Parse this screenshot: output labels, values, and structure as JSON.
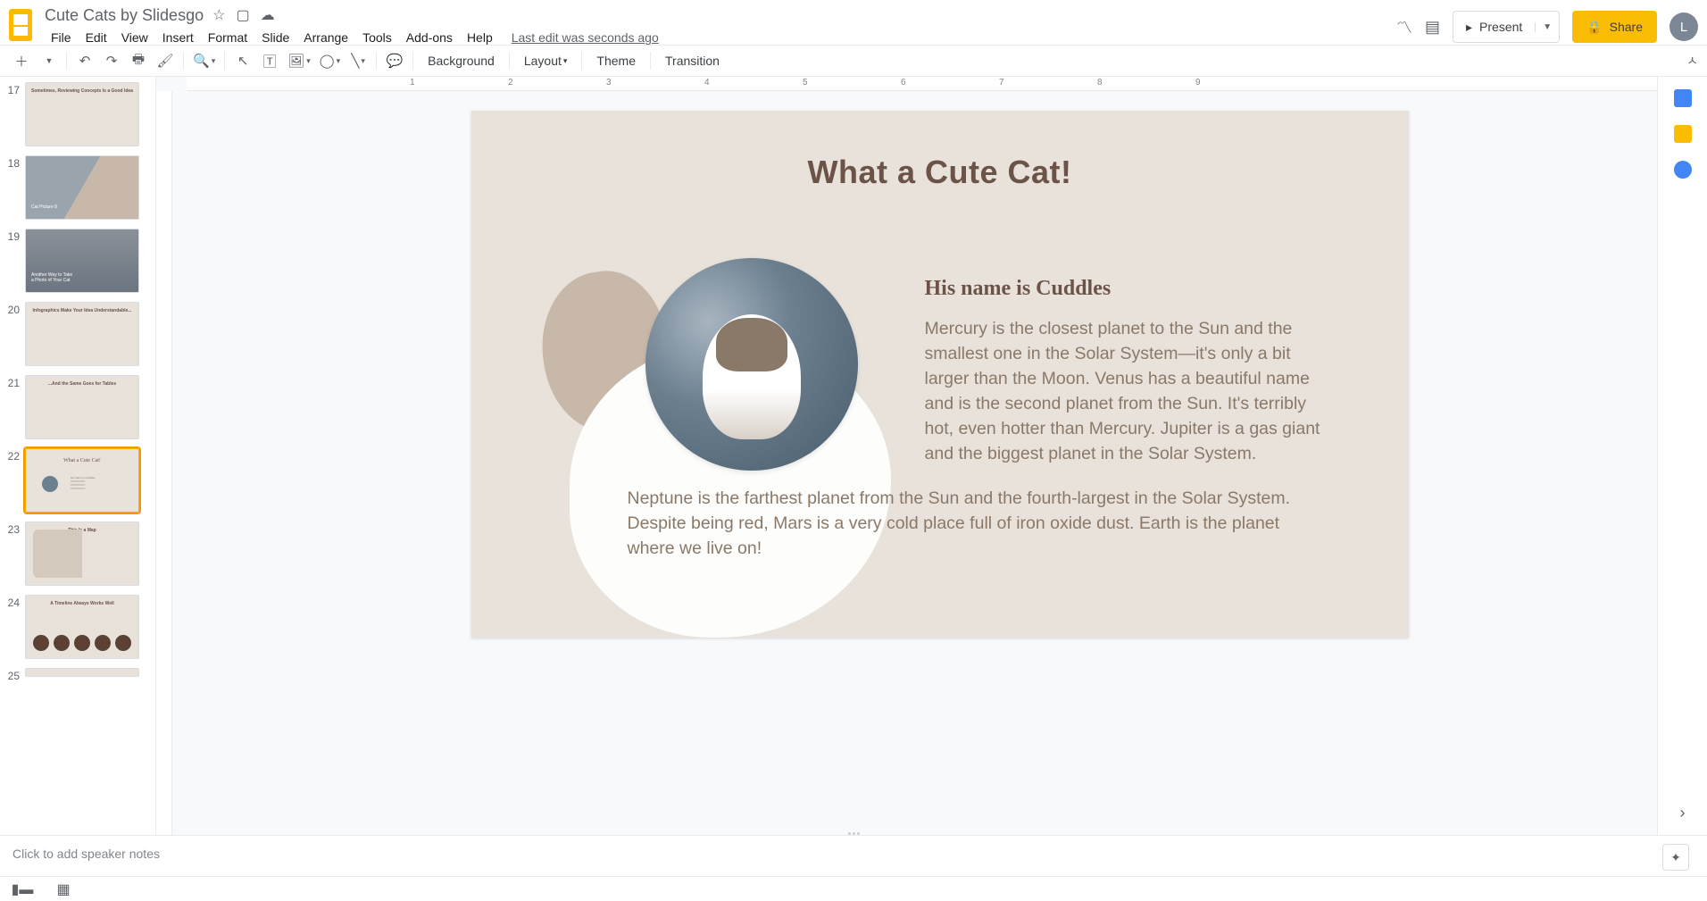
{
  "doc": {
    "title": "Cute Cats by Slidesgo"
  },
  "menu": {
    "file": "File",
    "edit": "Edit",
    "view": "View",
    "insert": "Insert",
    "format": "Format",
    "slide": "Slide",
    "arrange": "Arrange",
    "tools": "Tools",
    "addons": "Add-ons",
    "help": "Help",
    "lastedit": "Last edit was seconds ago"
  },
  "header": {
    "present": "Present",
    "share": "Share",
    "avatar": "L"
  },
  "toolbar": {
    "background": "Background",
    "layout": "Layout",
    "theme": "Theme",
    "transition": "Transition"
  },
  "filmstrip": {
    "nums": [
      "17",
      "18",
      "19",
      "20",
      "21",
      "22",
      "23",
      "24",
      "25"
    ],
    "t17": "Sometimes, Reviewing Concepts Is a Good Idea",
    "t18": "Cat Picture 8",
    "t19": "Another Way to Take a Photo of Your Cat",
    "t20": "Infographics Make Your Idea Understandable...",
    "t21": "...And the Same Goes for Tables",
    "t22": "What a Cute Cat!",
    "t22sub": "His name is Cuddles",
    "t23": "This Is a Map",
    "t24": "A Timeline Always Works Well"
  },
  "slide": {
    "title": "What a Cute Cat!",
    "subtitle": "His name is Cuddles",
    "p1": "Mercury is the closest planet to the Sun and the smallest one in the Solar System—it's only a bit larger than the Moon. Venus has a beautiful name and is the second planet from the Sun. It's terribly hot, even hotter than Mercury. Jupiter is a gas giant and the biggest planet in the Solar System.",
    "p2": "Neptune is the farthest planet from the Sun and the fourth-largest in the Solar System. Despite being red, Mars is a very cold place full of iron oxide dust. Earth is the planet where we live on!"
  },
  "ruler": {
    "n": [
      "1",
      "2",
      "3",
      "4",
      "5",
      "6",
      "7",
      "8",
      "9"
    ]
  },
  "notes": {
    "placeholder": "Click to add speaker notes"
  }
}
